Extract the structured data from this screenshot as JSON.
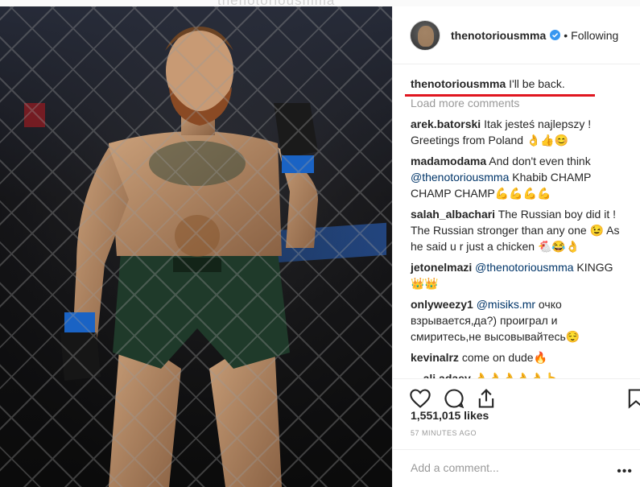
{
  "ghost_header": "thenotoriousmma",
  "post": {
    "username": "thenotoriousmma",
    "follow_status": "Following",
    "separator": "•",
    "caption_username": "thenotoriousmma",
    "caption_text": "I'll be back."
  },
  "load_more_label": "Load more comments",
  "comments": [
    {
      "user": "arek.batorski",
      "text": "Itak jesteś najlepszy ! Greetings from Poland 👌👍😊"
    },
    {
      "user": "madamodama",
      "text": "And don't even think",
      "mention": "@thenotoriousmma",
      "text2": "Khabib CHAMP CHAMP CHAMP💪💪💪💪"
    },
    {
      "user": "salah_albachari",
      "text": "The Russian boy did it ! The Russian stronger than any one 😉 As he said u r just a chicken 🐔😂👌"
    },
    {
      "user": "jetonelmazi",
      "mention": "@thenotoriousmma",
      "text2": "KINGG 👑👑"
    },
    {
      "user": "onlyweezy1",
      "mention": "@misiks.mr",
      "text2": "очко взрывается,да?) проиграл и смиритесь,не высовывайтесь😌"
    },
    {
      "user": "kevinalrz",
      "text": "come on dude🔥"
    },
    {
      "user": "__ali.adaev",
      "text": "👌👌👌👌👌👆"
    }
  ],
  "likes": "1,551,015 likes",
  "timestamp": "57 MINUTES AGO",
  "add_comment_placeholder": "Add a comment...",
  "colors": {
    "accent_red": "#e0161f",
    "verified_blue": "#3897f0",
    "muted": "#999999",
    "mention": "#003569"
  },
  "icons": {
    "like": "heart-icon",
    "comment": "comment-icon",
    "share": "share-icon",
    "save": "bookmark-icon",
    "more": "more-options-icon",
    "verified": "verified-badge-icon"
  }
}
